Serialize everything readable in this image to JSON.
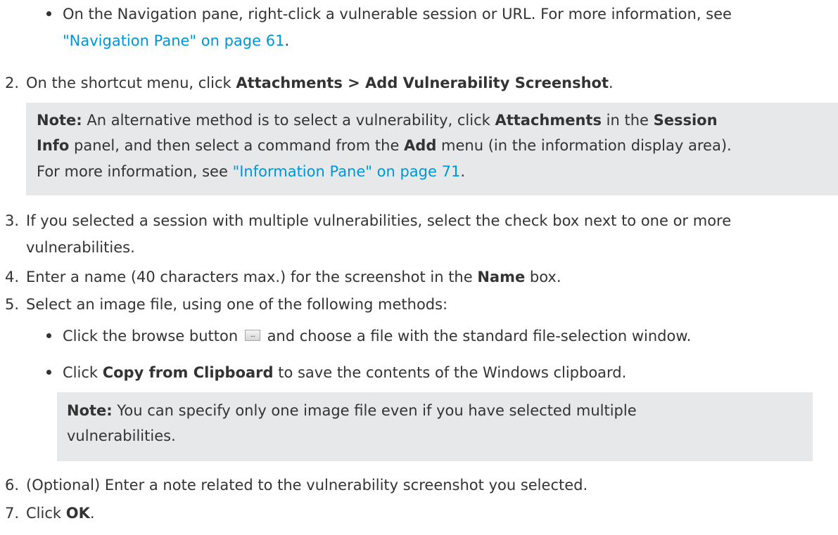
{
  "bullet_nav": {
    "text_a": "On the Navigation pane, right-click a vulnerable session or URL. For more information, see",
    "link": "\"Navigation Pane\" on page 61",
    "end": "."
  },
  "step2": {
    "num": "2.",
    "pre": "On the shortcut menu, click ",
    "bold": "Attachments > Add Vulnerability Screenshot",
    "end": "."
  },
  "note1": {
    "label": "Note:",
    "t1": " An alternative method is to select a vulnerability, click ",
    "b1": "Attachments",
    "t2": " in the ",
    "b2a": "Session",
    "b2b": "Info",
    "t3": " panel, and then select a command from the ",
    "b3": "Add",
    "t4": " menu (in the information display area).",
    "t5": "For more information, see ",
    "link": "\"Information Pane\" on page 71",
    "end": "."
  },
  "step3": {
    "num": "3.",
    "line1": "If you selected a session with multiple vulnerabilities, select the check box next to one or more",
    "line2": "vulnerabilities."
  },
  "step4": {
    "num": "4.",
    "pre": "Enter a name (40 characters max.) for the screenshot in the ",
    "bold": "Name",
    "post": " box."
  },
  "step5": {
    "num": "5.",
    "text": "Select an image file, using one of the following methods:"
  },
  "bullet_browse": {
    "pre": "Click the browse button",
    "icon_dots": "...",
    "post": "and choose a file with the standard file-selection window."
  },
  "bullet_clipboard": {
    "pre": "Click ",
    "bold": "Copy from Clipboard",
    "post": " to save the contents of the Windows clipboard."
  },
  "note2": {
    "label": "Note:",
    "line1": " You can specify only one image file even if you have selected multiple",
    "line2": "vulnerabilities."
  },
  "step6": {
    "num": "6.",
    "text": "(Optional) Enter a note related to the vulnerability screenshot you selected."
  },
  "step7": {
    "num": "7.",
    "pre": "Click ",
    "bold": "OK",
    "end": "."
  },
  "colors": {
    "text": "#333333",
    "link": "#0096d6",
    "note_background": "#e6e8ea"
  }
}
